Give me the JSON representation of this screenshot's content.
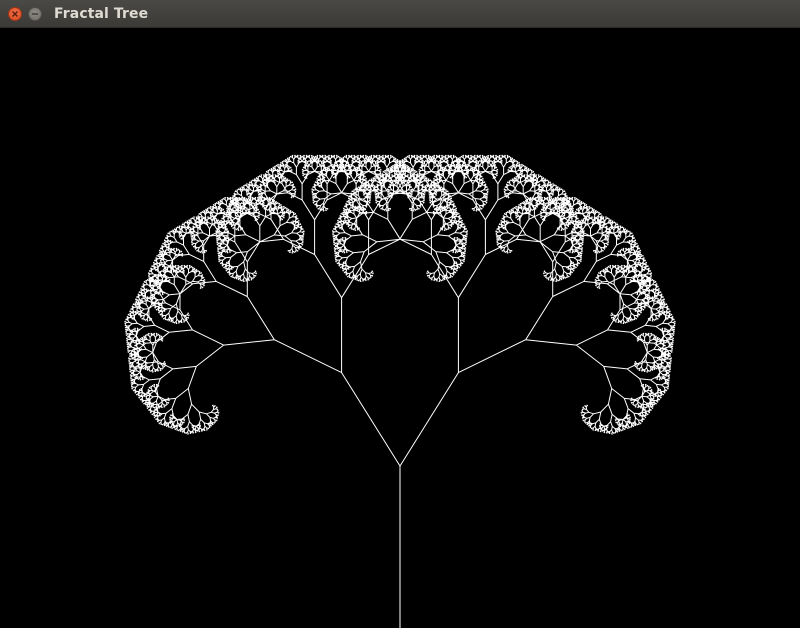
{
  "window": {
    "title": "Fractal Tree",
    "background_color": "#000000",
    "stroke_color": "#ffffff"
  },
  "titlebar": {
    "buttons": [
      {
        "name": "close",
        "icon": "close-icon",
        "color": "#e95420"
      },
      {
        "name": "minimize",
        "icon": "minimize-icon",
        "color": "#7a7772"
      }
    ]
  },
  "fractal": {
    "branch_angle_deg": 32,
    "length_ratio": 0.68,
    "depth": 13
  }
}
